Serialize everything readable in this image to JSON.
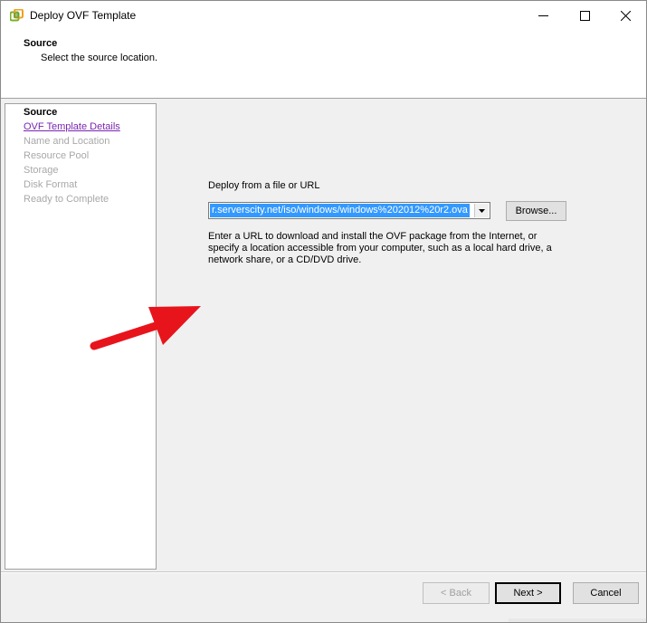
{
  "window": {
    "title": "Deploy OVF Template",
    "icon": "vsphere-app-icon"
  },
  "header": {
    "title": "Source",
    "subtitle": "Select the source location."
  },
  "nav": {
    "items": [
      {
        "label": "Source",
        "state": "active"
      },
      {
        "label": "OVF Template Details",
        "state": "link"
      },
      {
        "label": "Name and Location",
        "state": "disabled"
      },
      {
        "label": "Resource Pool",
        "state": "disabled"
      },
      {
        "label": "Storage",
        "state": "disabled"
      },
      {
        "label": "Disk Format",
        "state": "disabled"
      },
      {
        "label": "Ready to Complete",
        "state": "disabled"
      }
    ]
  },
  "content": {
    "field_label": "Deploy from a file or URL",
    "url_value": "r.serverscity.net/iso/windows/windows%202012%20r2.ova",
    "browse_label": "Browse...",
    "help_text": "Enter a URL to download and install the OVF package from the Internet, or specify a location accessible from your computer, such as a local hard drive, a network share, or a CD/DVD drive."
  },
  "footer": {
    "back_label": "< Back",
    "next_label": "Next >",
    "cancel_label": "Cancel"
  },
  "colors": {
    "selection": "#3399ff",
    "link": "#7a25b0",
    "disabled_text": "#a8a8a8",
    "annotation_arrow": "#e8141c"
  }
}
